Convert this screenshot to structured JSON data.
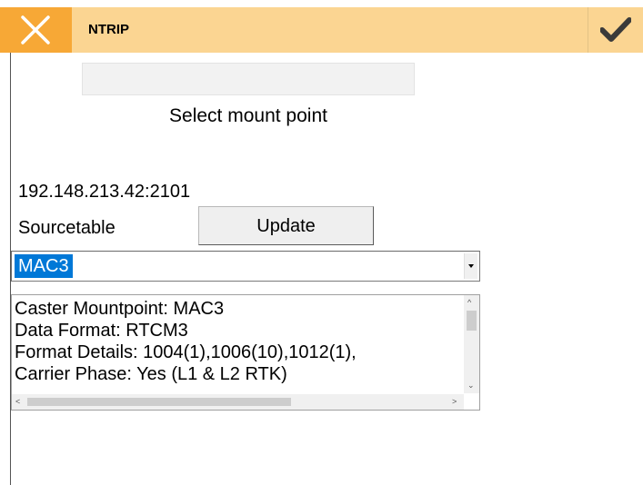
{
  "header": {
    "title": "NTRIP",
    "close_icon": "close-icon",
    "confirm_icon": "checkmark-icon",
    "bar_color": "#fbd592",
    "close_bg_color": "#f7a836"
  },
  "form": {
    "top_field_value": "",
    "select_mount_label": "Select mount point",
    "caster_address": "192.148.213.42:2101",
    "sourcetable_label": "Sourcetable",
    "update_button_label": "Update",
    "mountpoint_selected": "MAC3",
    "selection_color": "#0078d7"
  },
  "details": {
    "lines": [
      "Caster Mountpoint: MAC3",
      "Data Format: RTCM3",
      "Format Details: 1004(1),1006(10),1012(1),",
      "Carrier Phase: Yes (L1 & L2 RTK)"
    ]
  }
}
